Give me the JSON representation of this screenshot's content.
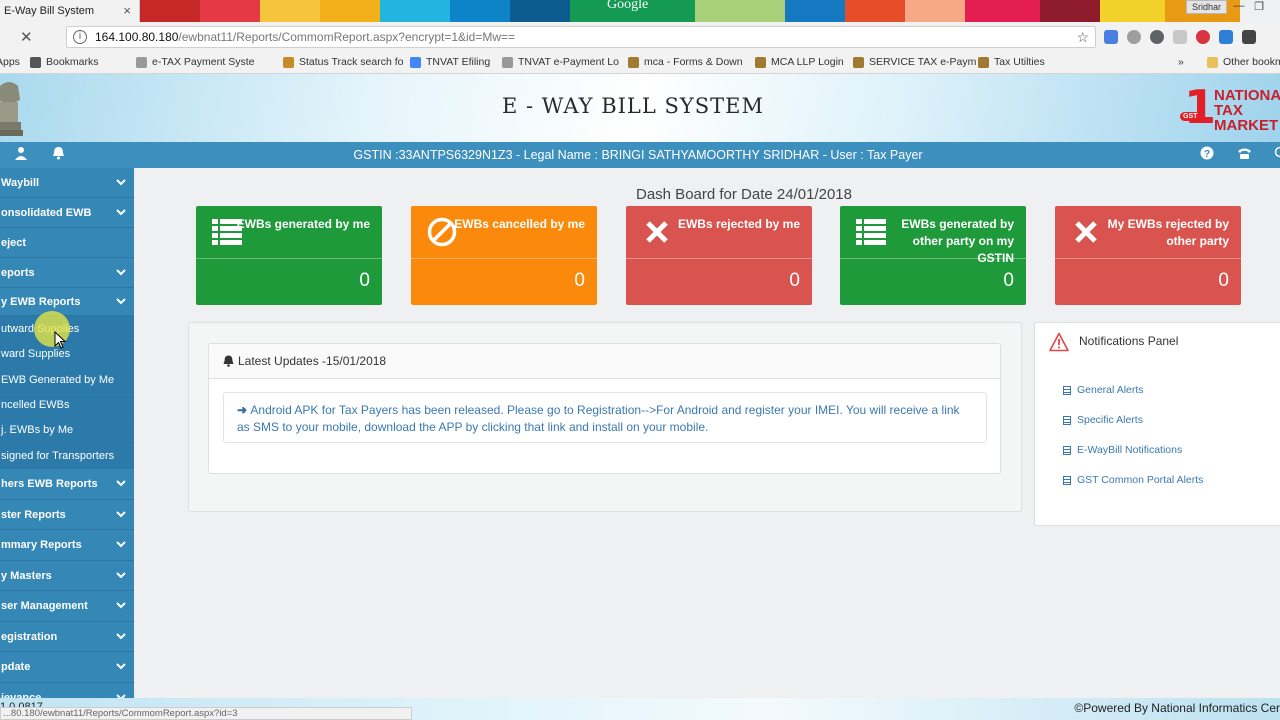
{
  "browser": {
    "tab_title": "E-Way Bill System",
    "tab_close": "×",
    "google_text": "Google",
    "user_name": "Sridhar",
    "url_host": "164.100.80.180",
    "url_path": "/ewbnat11/Reports/CommomReport.aspx?encrypt=1&id=Mw==",
    "status_url": "...80.180/ewbnat11/Reports/CommomReport.aspx?id=3",
    "bookmarks": [
      {
        "label": "Apps",
        "icon": "apps-icon"
      },
      {
        "label": "Bookmarks",
        "icon": "star-icon"
      },
      {
        "label": "e-TAX Payment Syste",
        "icon": "page-icon"
      },
      {
        "label": "Status Track search fo",
        "icon": "tracking-icon"
      },
      {
        "label": "TNVAT Efiling",
        "icon": "google-icon"
      },
      {
        "label": "TNVAT e-Payment Lo",
        "icon": "page-icon"
      },
      {
        "label": "mca - Forms & Down",
        "icon": "emblem-icon"
      },
      {
        "label": "MCA LLP Login",
        "icon": "emblem-icon"
      },
      {
        "label": "SERVICE TAX e-Paym",
        "icon": "emblem-icon"
      },
      {
        "label": "Tax Utilties",
        "icon": "emblem-icon"
      },
      {
        "label": "»",
        "icon": ""
      },
      {
        "label": "Other bookm",
        "icon": "folder-icon"
      }
    ]
  },
  "header": {
    "title": "E - WAY BILL SYSTEM",
    "brand_words": [
      "NATIONAL",
      "TAX",
      "MARKET"
    ],
    "brand_badge": "GST",
    "info_bar": "GSTIN :33ANTPS6329N1Z3 - Legal Name : BRINGI SATHYAMOORTHY SRIDHAR - User : Tax Payer"
  },
  "sidebar": {
    "items": [
      {
        "label": "Waybill",
        "chevron": true
      },
      {
        "label": "onsolidated EWB",
        "chevron": true
      },
      {
        "label": "eject",
        "chevron": false
      },
      {
        "label": "eports",
        "chevron": true
      },
      {
        "label": "y EWB Reports",
        "chevron": true
      },
      {
        "label": "utward Supplies",
        "chevron": false,
        "sub": true
      },
      {
        "label": "ward Supplies",
        "chevron": false,
        "sub": true
      },
      {
        "label": "EWB Generated by Me",
        "chevron": false,
        "sub": true
      },
      {
        "label": "ncelled EWBs",
        "chevron": false,
        "sub": true
      },
      {
        "label": "j. EWBs by Me",
        "chevron": false,
        "sub": true
      },
      {
        "label": "signed for Transporters",
        "chevron": false,
        "sub": true
      },
      {
        "label": "hers EWB Reports",
        "chevron": true
      },
      {
        "label": "ster Reports",
        "chevron": true
      },
      {
        "label": "mmary Reports",
        "chevron": true
      },
      {
        "label": "y Masters",
        "chevron": true
      },
      {
        "label": "ser Management",
        "chevron": true
      },
      {
        "label": "egistration",
        "chevron": true
      },
      {
        "label": "pdate",
        "chevron": true
      },
      {
        "label": "ievance",
        "chevron": true
      }
    ]
  },
  "dashboard": {
    "title": "Dash Board for Date 24/01/2018",
    "cards": [
      {
        "label": "EWBs generated by me",
        "count": "0",
        "color": "#1f9a3a",
        "icon": "list-icon"
      },
      {
        "label": "EWBs cancelled by me",
        "count": "0",
        "color": "#fb8a0c",
        "icon": "ban-icon"
      },
      {
        "label": "EWBs rejected by me",
        "count": "0",
        "color": "#d9534f",
        "icon": "close-icon"
      },
      {
        "label": "EWBs generated by other party on my GSTIN",
        "count": "0",
        "color": "#1f9a3a",
        "icon": "list-icon"
      },
      {
        "label": "My EWBs rejected by other party",
        "count": "0",
        "color": "#d9534f",
        "icon": "close-icon"
      }
    ]
  },
  "updates": {
    "heading": "Latest Updates -15/01/2018",
    "item": "Android APK for Tax Payers has been released. Please go to Registration-->For Android and register your IMEI. You will receive a link as SMS to your mobile, download the APP by clicking that link and install on your mobile."
  },
  "notifications": {
    "title": "Notifications Panel",
    "links": [
      "General Alerts",
      "Specific Alerts",
      "E-WayBill Notifications",
      "GST Common Portal Alerts"
    ]
  },
  "footer": {
    "version": "1.0.0817",
    "powered": "Powered By National Informatics Cer"
  },
  "colors": {
    "sidebar": "#3587b6",
    "info_bar": "#3d8fbe",
    "green": "#1f9a3a",
    "orange": "#fb8a0c",
    "red": "#d9534f",
    "link": "#3a79b0"
  }
}
